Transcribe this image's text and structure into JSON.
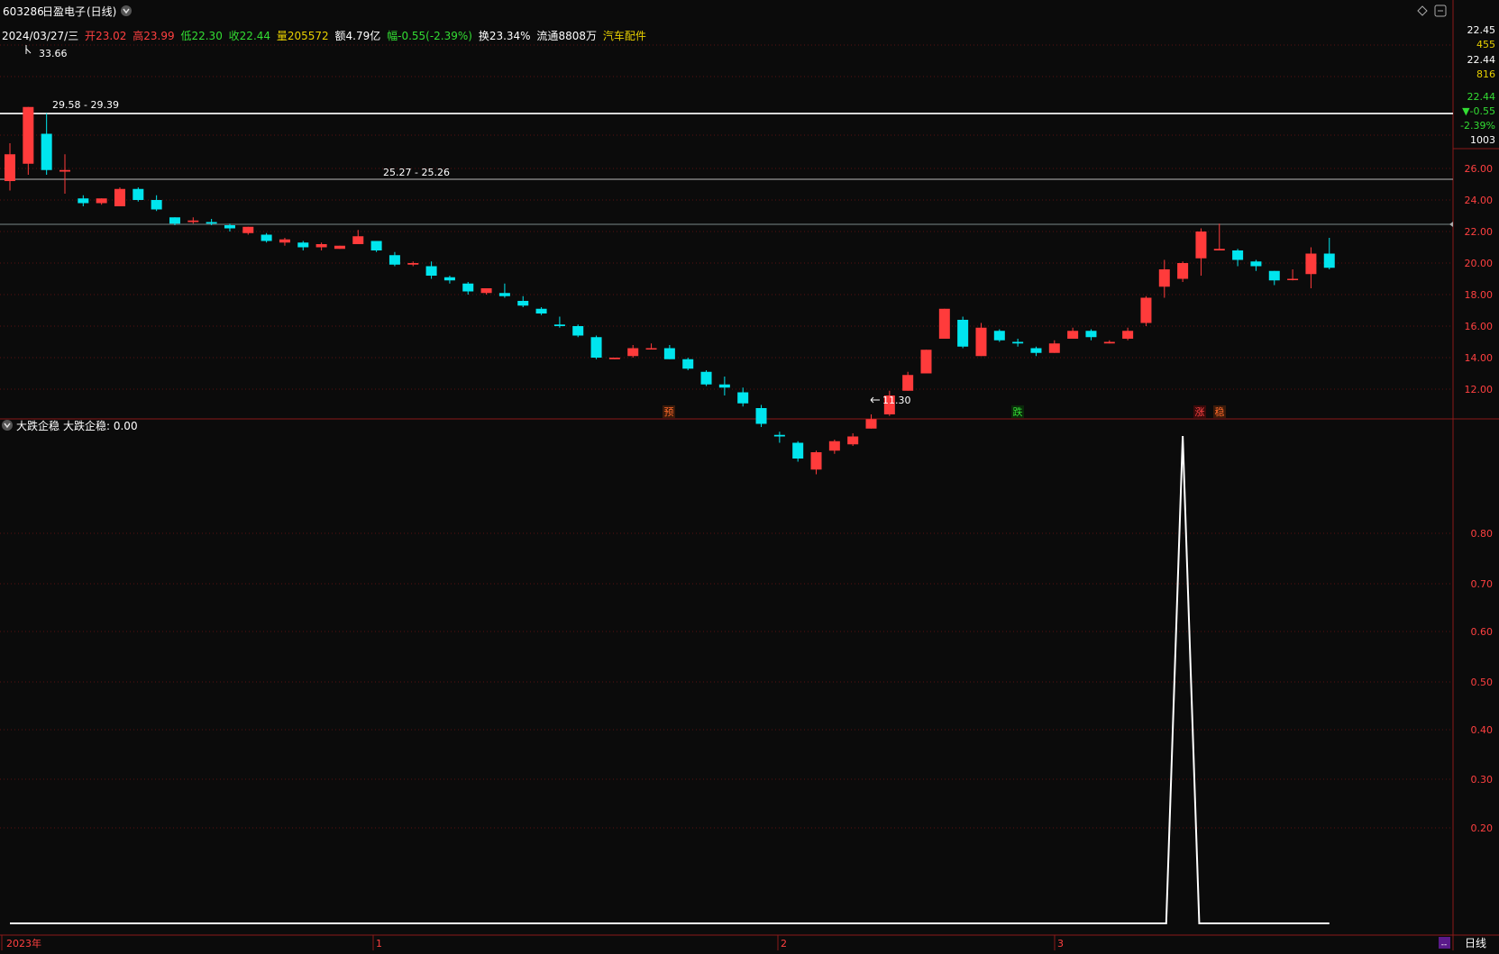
{
  "header": {
    "code": "603286",
    "name": "日盈电子",
    "period": "(日线)",
    "date": "2024/03/27/三",
    "open_label": "开",
    "open": "23.02",
    "high_label": "高",
    "high": "23.99",
    "low_label": "低",
    "low": "22.30",
    "close_label": "收",
    "close": "22.44",
    "volume_label": "量",
    "volume": "205572",
    "amount_label": "额",
    "amount": "4.79亿",
    "change_label": "幅",
    "change": "-0.55(-2.39%)",
    "turnover_label": "换",
    "turnover": "23.34%",
    "float_label": "流通",
    "float": "8808万",
    "industry": "汽车配件"
  },
  "right_panel": {
    "price_high": "22.45",
    "vol_high": "455",
    "price_low": "22.44",
    "vol_low": "816",
    "last_price": "22.44",
    "last_change": "▼-0.55",
    "last_pct": "-2.39%",
    "last_vol": "1003"
  },
  "price_axis": [
    "26.00",
    "24.00",
    "22.00",
    "20.00",
    "18.00",
    "16.00",
    "14.00",
    "12.00"
  ],
  "annotations": {
    "high_point": "33.66",
    "low_point": "11.30",
    "range_1": "29.58 - 29.39",
    "range_2": "25.27 - 25.26"
  },
  "signals": [
    {
      "text": "预",
      "color": "#ff6a2a"
    },
    {
      "text": "跌",
      "color": "#33dd33"
    },
    {
      "text": "涨",
      "color": "#ff4444"
    },
    {
      "text": "稳",
      "color": "#ff6a2a"
    }
  ],
  "indicator": {
    "name": "大跌企稳",
    "label": "大跌企稳: 0.00",
    "axis": [
      "0.80",
      "0.70",
      "0.60",
      "0.50",
      "0.40",
      "0.30",
      "0.20"
    ]
  },
  "time_axis": [
    "2023年",
    "1",
    "2",
    "3"
  ],
  "period_tab": "日线",
  "colors": {
    "up": "#ff3b3b",
    "down": "#00e5ee",
    "grid": "#5a1010",
    "border": "#8b1a1a",
    "text_white": "#ffffff",
    "text_red": "#ff4040",
    "text_green": "#33dd33",
    "text_yellow": "#e8d000",
    "text_cyan": "#00e5ee"
  },
  "chart_data": [
    {
      "type": "candlestick",
      "title": "603286 日盈电子 (日线)",
      "y_axis_range": [
        11.3,
        33.66
      ],
      "candles": [
        {
          "o": 25.2,
          "c": 26.9,
          "h": 27.6,
          "l": 24.6
        },
        {
          "o": 26.3,
          "c": 29.9,
          "h": 29.9,
          "l": 25.6
        },
        {
          "o": 28.2,
          "c": 25.9,
          "h": 29.5,
          "l": 25.6
        },
        {
          "o": 25.8,
          "c": 25.9,
          "h": 26.9,
          "l": 24.4
        },
        {
          "o": 24.1,
          "c": 23.8,
          "h": 24.3,
          "l": 23.6
        },
        {
          "o": 23.8,
          "c": 24.1,
          "h": 24.1,
          "l": 23.7
        },
        {
          "o": 23.6,
          "c": 24.7,
          "h": 24.8,
          "l": 23.6
        },
        {
          "o": 24.7,
          "c": 24.0,
          "h": 24.8,
          "l": 23.9
        },
        {
          "o": 24.0,
          "c": 23.4,
          "h": 24.3,
          "l": 23.3
        },
        {
          "o": 22.9,
          "c": 22.5,
          "h": 22.9,
          "l": 22.4
        },
        {
          "o": 22.6,
          "c": 22.7,
          "h": 22.9,
          "l": 22.5
        },
        {
          "o": 22.6,
          "c": 22.5,
          "h": 22.8,
          "l": 22.4
        },
        {
          "o": 22.4,
          "c": 22.2,
          "h": 22.5,
          "l": 22.0
        },
        {
          "o": 21.9,
          "c": 22.3,
          "h": 22.3,
          "l": 21.8
        },
        {
          "o": 21.8,
          "c": 21.4,
          "h": 21.9,
          "l": 21.3
        },
        {
          "o": 21.3,
          "c": 21.5,
          "h": 21.6,
          "l": 21.1
        },
        {
          "o": 21.3,
          "c": 21.0,
          "h": 21.4,
          "l": 20.8
        },
        {
          "o": 21.0,
          "c": 21.2,
          "h": 21.3,
          "l": 20.8
        },
        {
          "o": 20.9,
          "c": 21.1,
          "h": 21.1,
          "l": 20.9
        },
        {
          "o": 21.2,
          "c": 21.7,
          "h": 22.1,
          "l": 21.2
        },
        {
          "o": 21.4,
          "c": 20.8,
          "h": 21.4,
          "l": 20.7
        },
        {
          "o": 20.5,
          "c": 19.9,
          "h": 20.7,
          "l": 19.8
        },
        {
          "o": 19.9,
          "c": 20.0,
          "h": 20.1,
          "l": 19.8
        },
        {
          "o": 19.8,
          "c": 19.2,
          "h": 20.1,
          "l": 19.0
        },
        {
          "o": 19.1,
          "c": 18.9,
          "h": 19.2,
          "l": 18.7
        },
        {
          "o": 18.7,
          "c": 18.2,
          "h": 18.8,
          "l": 18.0
        },
        {
          "o": 18.1,
          "c": 18.4,
          "h": 18.4,
          "l": 18.0
        },
        {
          "o": 18.1,
          "c": 17.9,
          "h": 18.7,
          "l": 17.8
        },
        {
          "o": 17.6,
          "c": 17.3,
          "h": 17.9,
          "l": 17.2
        },
        {
          "o": 17.1,
          "c": 16.8,
          "h": 17.2,
          "l": 16.7
        },
        {
          "o": 16.1,
          "c": 16.0,
          "h": 16.6,
          "l": 15.9
        },
        {
          "o": 16.0,
          "c": 15.4,
          "h": 16.1,
          "l": 15.3
        },
        {
          "o": 15.3,
          "c": 14.0,
          "h": 15.4,
          "l": 13.9
        },
        {
          "o": 13.9,
          "c": 14.0,
          "h": 14.0,
          "l": 13.9
        },
        {
          "o": 14.1,
          "c": 14.6,
          "h": 14.8,
          "l": 14.0
        },
        {
          "o": 14.6,
          "c": 14.6,
          "h": 14.9,
          "l": 14.6
        },
        {
          "o": 14.6,
          "c": 13.9,
          "h": 14.8,
          "l": 13.9
        },
        {
          "o": 13.9,
          "c": 13.3,
          "h": 14.0,
          "l": 13.2
        },
        {
          "o": 13.1,
          "c": 12.3,
          "h": 13.2,
          "l": 12.2
        },
        {
          "o": 12.3,
          "c": 12.1,
          "h": 12.8,
          "l": 11.6
        },
        {
          "o": 11.8,
          "c": 11.1,
          "h": 12.1,
          "l": 10.9
        },
        {
          "o": 10.8,
          "c": 9.8,
          "h": 11.0,
          "l": 9.6
        },
        {
          "o": 9.1,
          "c": 9.0,
          "h": 9.3,
          "l": 8.6
        },
        {
          "o": 8.6,
          "c": 7.6,
          "h": 8.7,
          "l": 7.4
        },
        {
          "o": 6.9,
          "c": 8.0,
          "h": 8.1,
          "l": 6.6
        },
        {
          "o": 8.1,
          "c": 8.7,
          "h": 8.8,
          "l": 7.9
        },
        {
          "o": 8.5,
          "c": 9.0,
          "h": 9.2,
          "l": 8.4
        },
        {
          "o": 9.5,
          "c": 10.1,
          "h": 10.4,
          "l": 9.5
        },
        {
          "o": 10.4,
          "c": 11.6,
          "h": 11.9,
          "l": 10.3
        },
        {
          "o": 11.9,
          "c": 12.9,
          "h": 13.1,
          "l": 11.9
        },
        {
          "o": 13.0,
          "c": 14.5,
          "h": 14.5,
          "l": 13.0
        },
        {
          "o": 15.2,
          "c": 17.1,
          "h": 17.1,
          "l": 15.2
        },
        {
          "o": 16.4,
          "c": 14.7,
          "h": 16.6,
          "l": 14.6
        },
        {
          "o": 14.1,
          "c": 15.9,
          "h": 16.2,
          "l": 14.1
        },
        {
          "o": 15.7,
          "c": 15.1,
          "h": 15.8,
          "l": 15.0
        },
        {
          "o": 15.0,
          "c": 14.9,
          "h": 15.2,
          "l": 14.7
        },
        {
          "o": 14.6,
          "c": 14.3,
          "h": 14.7,
          "l": 14.1
        },
        {
          "o": 14.3,
          "c": 14.9,
          "h": 15.1,
          "l": 14.3
        },
        {
          "o": 15.2,
          "c": 15.7,
          "h": 15.9,
          "l": 15.2
        },
        {
          "o": 15.7,
          "c": 15.3,
          "h": 15.8,
          "l": 15.1
        },
        {
          "o": 14.9,
          "c": 15.0,
          "h": 15.1,
          "l": 14.9
        },
        {
          "o": 15.2,
          "c": 15.7,
          "h": 15.9,
          "l": 15.1
        },
        {
          "o": 16.2,
          "c": 17.8,
          "h": 17.9,
          "l": 16.0
        },
        {
          "o": 18.5,
          "c": 19.6,
          "h": 20.2,
          "l": 17.8
        },
        {
          "o": 19.0,
          "c": 20.0,
          "h": 20.1,
          "l": 18.8
        },
        {
          "o": 20.3,
          "c": 22.0,
          "h": 22.2,
          "l": 19.2
        },
        {
          "o": 20.8,
          "c": 20.9,
          "h": 22.5,
          "l": 20.8
        },
        {
          "o": 20.8,
          "c": 20.2,
          "h": 20.9,
          "l": 19.8
        },
        {
          "o": 20.1,
          "c": 19.8,
          "h": 20.2,
          "l": 19.5
        },
        {
          "o": 19.5,
          "c": 18.9,
          "h": 19.5,
          "l": 18.6
        },
        {
          "o": 19.0,
          "c": 19.0,
          "h": 19.6,
          "l": 18.9
        },
        {
          "o": 19.3,
          "c": 20.6,
          "h": 21.0,
          "l": 18.4
        },
        {
          "o": 20.6,
          "c": 19.7,
          "h": 21.6,
          "l": 19.6
        }
      ]
    },
    {
      "type": "line",
      "title": "大跌企稳",
      "ylim": [
        0,
        1
      ],
      "y_ticks": [
        0.2,
        0.3,
        0.4,
        0.5,
        0.6,
        0.7,
        0.8
      ],
      "x": [
        0,
        1,
        2,
        3,
        4,
        5,
        6,
        7,
        8,
        9,
        10,
        11,
        12,
        13,
        14,
        15,
        16,
        17,
        18,
        19,
        20,
        21,
        22,
        23,
        24,
        25,
        26,
        27,
        28,
        29,
        30,
        31,
        32,
        33,
        34,
        35,
        36,
        37,
        38,
        39,
        40,
        41,
        42,
        43,
        44,
        45,
        46,
        47,
        48,
        49,
        50,
        51,
        52,
        53,
        54,
        55,
        56,
        57,
        58,
        59,
        60,
        61,
        62,
        63,
        64,
        65,
        66,
        67,
        68,
        69,
        70,
        71,
        72
      ],
      "values": [
        0,
        0,
        0,
        0,
        0,
        0,
        0,
        0,
        0,
        0,
        0,
        0,
        0,
        0,
        0,
        0,
        0,
        0,
        0,
        0,
        0,
        0,
        0,
        0,
        0,
        0,
        0,
        0,
        0,
        0,
        0,
        0,
        0,
        0,
        0,
        0,
        0,
        0,
        0,
        0,
        0,
        0,
        0,
        0,
        0,
        0,
        0,
        0,
        0,
        0,
        0,
        0,
        0,
        0,
        0,
        0,
        0,
        0,
        0,
        0,
        0,
        0,
        0,
        0,
        1,
        0,
        0,
        0,
        0,
        0,
        0,
        0,
        0
      ]
    }
  ]
}
